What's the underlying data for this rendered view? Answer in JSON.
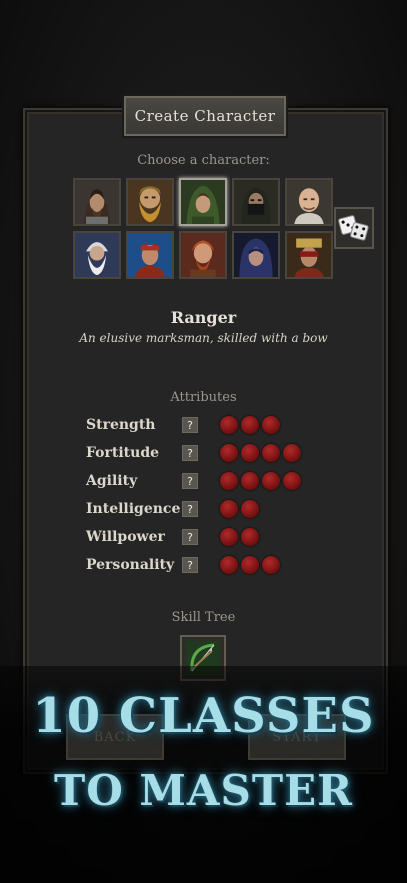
{
  "dialog": {
    "title": "Create Character",
    "choose_label": "Choose a character:"
  },
  "portraits": [
    {
      "name": "portrait-1",
      "icon": "long-haired-man-portrait",
      "selected": false
    },
    {
      "name": "portrait-2",
      "icon": "bearded-dwarf-portrait",
      "selected": false
    },
    {
      "name": "portrait-3",
      "icon": "hooded-ranger-portrait",
      "selected": true
    },
    {
      "name": "portrait-4",
      "icon": "masked-assassin-portrait",
      "selected": false
    },
    {
      "name": "portrait-5",
      "icon": "bald-monk-portrait",
      "selected": false
    },
    {
      "name": "portrait-6",
      "icon": "white-bearded-wizard-portrait",
      "selected": false
    },
    {
      "name": "portrait-7",
      "icon": "red-capped-man-portrait",
      "selected": false
    },
    {
      "name": "portrait-8",
      "icon": "red-haired-warrior-portrait",
      "selected": false
    },
    {
      "name": "portrait-9",
      "icon": "blue-hooded-woman-portrait",
      "selected": false
    },
    {
      "name": "portrait-10",
      "icon": "headdress-woman-portrait",
      "selected": false
    }
  ],
  "randomize": {
    "icon": "dice-icon"
  },
  "character": {
    "name": "Ranger",
    "description": "An elusive marksman, skilled with a bow"
  },
  "attributes": {
    "heading": "Attributes",
    "help_symbol": "?",
    "items": [
      {
        "label": "Strength",
        "value": 3
      },
      {
        "label": "Fortitude",
        "value": 4
      },
      {
        "label": "Agility",
        "value": 4
      },
      {
        "label": "Intelligence",
        "value": 2
      },
      {
        "label": "Willpower",
        "value": 2
      },
      {
        "label": "Personality",
        "value": 3
      }
    ]
  },
  "skill_tree": {
    "heading": "Skill Tree",
    "icon": "bow-icon"
  },
  "buttons": {
    "back": "BACK",
    "start": "START"
  },
  "promo": {
    "line1": "10 CLASSES",
    "line2": "TO MASTER"
  },
  "colors": {
    "attribute_dot": "#8b1717",
    "promo_text": "#a6dde6",
    "panel": "#252525"
  }
}
